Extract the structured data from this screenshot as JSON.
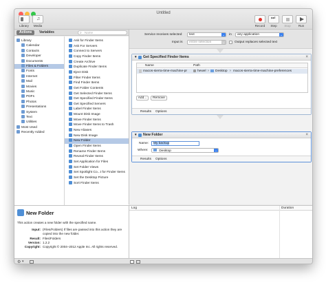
{
  "window": {
    "title": "Untitled"
  },
  "toolbar": {
    "library_label": "Library",
    "media_label": "Media",
    "record_label": "Record",
    "step_label": "Step",
    "stop_label": "Stop",
    "run_label": "Run"
  },
  "tabs": {
    "actions": "Actions",
    "variables": "Variables"
  },
  "search": {
    "placeholder": "Name"
  },
  "library": {
    "items": [
      "Library",
      "Calendar",
      "Contacts",
      "Developer",
      "Documents",
      "Files & Folders",
      "Fonts",
      "Internet",
      "Mail",
      "Movies",
      "Music",
      "PDFs",
      "Photos",
      "Presentations",
      "System",
      "Text",
      "Utilities",
      "Most Used",
      "Recently Added"
    ],
    "selected": "Files & Folders"
  },
  "actions": {
    "items": [
      "Ask for Finder Items",
      "Ask For Servers",
      "Connect to Servers",
      "Copy Finder Items",
      "Create Archive",
      "Duplicate Finder Items",
      "Eject Disk",
      "Filter Finder Items",
      "Find Finder Items",
      "Get Folder Contents",
      "Get Selected Finder Items",
      "Get Specified Finder Items",
      "Get Specified Servers",
      "Label Finder Items",
      "Mount Disk Image",
      "Move Finder Items",
      "Move Finder Items to Trash",
      "New Aliases",
      "New Disk Image",
      "New Folder",
      "Open Finder Items",
      "Rename Finder Items",
      "Reveal Finder Items",
      "Set Application for Files",
      "Set Folder Views",
      "Set Spotlight Co...t for Finder Items",
      "Set the Desktop Picture",
      "Sort Finder Items"
    ],
    "selected": "New Folder"
  },
  "service": {
    "receives_label": "Service receives selected",
    "receives_value": "text",
    "in_label": "in",
    "in_value": "any application",
    "input_is_label": "Input is",
    "input_is_value": "entire selection",
    "output_label": "Output replaces selected text"
  },
  "action1": {
    "title": "Get Specified Finder Items",
    "col_name": "Name",
    "col_path": "Path",
    "row_name": "macos-sierra-time-machine-pr",
    "row_path": [
      "hewel",
      "Desktop",
      "macos-sierra-time-machine-preferences"
    ],
    "add_label": "Add...",
    "remove_label": "Remove",
    "results_label": "Results",
    "options_label": "Options"
  },
  "action2": {
    "title": "New Folder",
    "name_label": "Name:",
    "name_value": "My backup",
    "where_label": "Where:",
    "where_value": "Desktop",
    "results_label": "Results",
    "options_label": "Options"
  },
  "description": {
    "title": "New Folder",
    "summary": "This action creates a new folder with the specified name.",
    "input_label": "Input:",
    "input_value": "(Files/Folders) If files are passed into this action they are copied into the new folder.",
    "result_label": "Result:",
    "result_value": "Files/Folders",
    "version_label": "Version:",
    "version_value": "1.2.2",
    "copyright_label": "Copyright:",
    "copyright_value": "Copyright © 2004–2012 Apple Inc. All rights reserved."
  },
  "log": {
    "col_log": "Log",
    "col_duration": "Duration"
  },
  "colors": {
    "accent": "#3b82f0",
    "selection": "#b5c9e6",
    "record": "#e0302a"
  }
}
